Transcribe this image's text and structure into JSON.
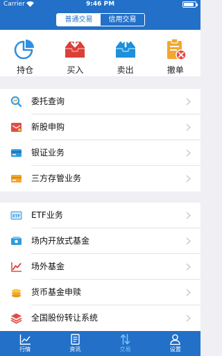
{
  "status": {
    "carrier": "Carrier",
    "time": "9:46 PM",
    "battery_level": 0.9
  },
  "segments": [
    {
      "label": "普通交易",
      "active": true
    },
    {
      "label": "信用交易",
      "active": false
    }
  ],
  "actions": [
    {
      "label": "持仓",
      "icon": "pie-chart-icon"
    },
    {
      "label": "买入",
      "icon": "inbox-download-icon"
    },
    {
      "label": "卖出",
      "icon": "inbox-upload-icon"
    },
    {
      "label": "撤单",
      "icon": "clipboard-cancel-icon"
    }
  ],
  "list_group_1": [
    {
      "label": "委托查询",
      "icon": "search-icon"
    },
    {
      "label": "新股申购",
      "icon": "new-stock-icon"
    },
    {
      "label": "银证业务",
      "icon": "bank-card-icon"
    },
    {
      "label": "三方存管业务",
      "icon": "card-icon"
    }
  ],
  "list_group_2": [
    {
      "label": "ETF业务",
      "icon": "etf-icon"
    },
    {
      "label": "场内开放式基金",
      "icon": "fund-icon"
    },
    {
      "label": "场外基金",
      "icon": "trend-chart-icon"
    },
    {
      "label": "货币基金申赎",
      "icon": "coins-icon"
    },
    {
      "label": "全国股份转让系统",
      "icon": "layers-icon"
    }
  ],
  "tabs": [
    {
      "label": "行情",
      "icon": "line-chart-icon",
      "active": false
    },
    {
      "label": "资讯",
      "icon": "document-icon",
      "active": false
    },
    {
      "label": "交易",
      "icon": "transfer-arrows-icon",
      "active": true
    },
    {
      "label": "设置",
      "icon": "person-icon",
      "active": false
    }
  ],
  "colors": {
    "primary": "#2270c8",
    "background": "#efeff4",
    "active_tab": "#7cc6ff"
  }
}
